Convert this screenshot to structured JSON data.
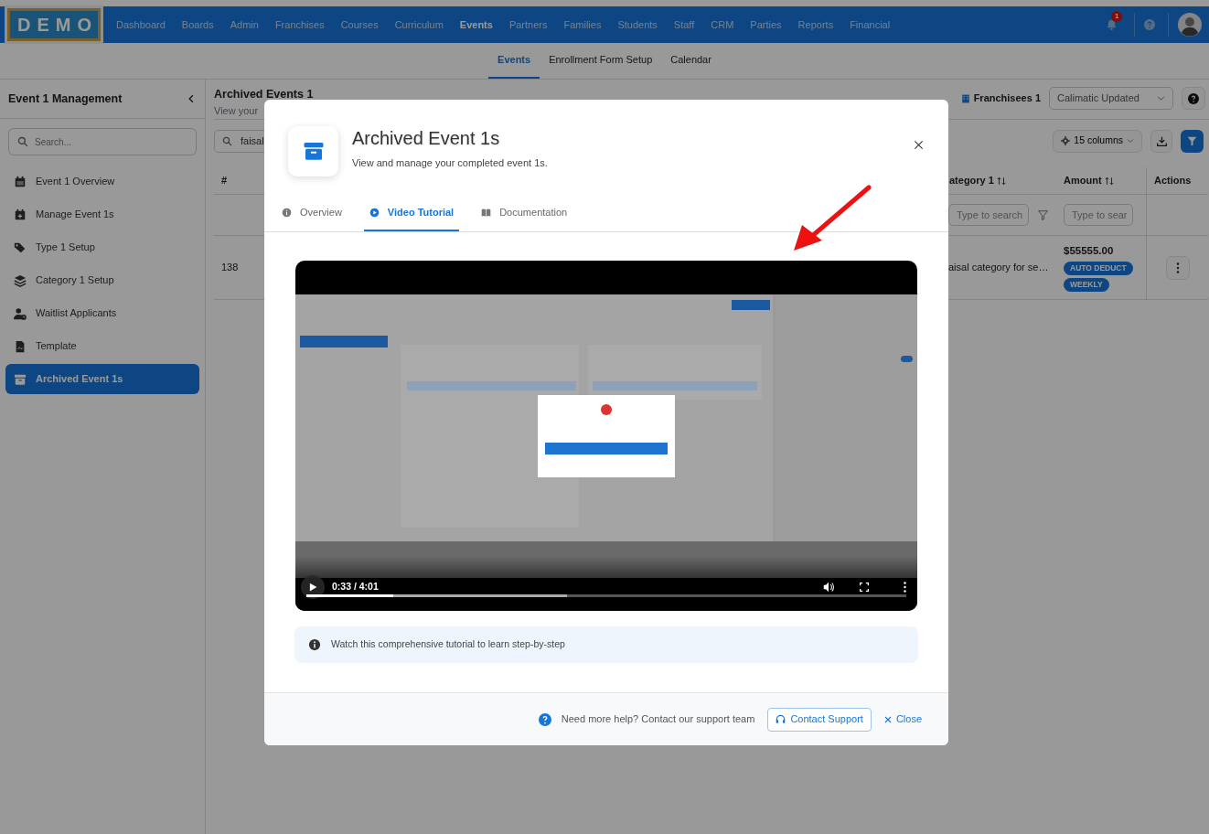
{
  "navbar": {
    "logo_text": "DEMO",
    "items": [
      {
        "label": "Dashboard",
        "selected": false
      },
      {
        "label": "Boards",
        "selected": false
      },
      {
        "label": "Admin",
        "selected": false
      },
      {
        "label": "Franchises",
        "selected": false
      },
      {
        "label": "Courses",
        "selected": false
      },
      {
        "label": "Curriculum",
        "selected": false
      },
      {
        "label": "Events",
        "selected": true
      },
      {
        "label": "Partners",
        "selected": false
      },
      {
        "label": "Families",
        "selected": false
      },
      {
        "label": "Students",
        "selected": false
      },
      {
        "label": "Staff",
        "selected": false
      },
      {
        "label": "CRM",
        "selected": false
      },
      {
        "label": "Parties",
        "selected": false
      },
      {
        "label": "Reports",
        "selected": false
      },
      {
        "label": "Financial",
        "selected": false
      }
    ],
    "notification_count": "1"
  },
  "subnav": [
    {
      "label": "Events",
      "selected": true
    },
    {
      "label": "Enrollment Form Setup",
      "selected": false
    },
    {
      "label": "Calendar",
      "selected": false
    }
  ],
  "sidebar": {
    "title": "Event 1 Management",
    "search_placeholder": "Search...",
    "items": [
      {
        "label": "Event 1 Overview",
        "selected": false
      },
      {
        "label": "Manage Event 1s",
        "selected": false
      },
      {
        "label": "Type 1 Setup",
        "selected": false
      },
      {
        "label": "Category 1 Setup",
        "selected": false
      },
      {
        "label": "Waitlist Applicants",
        "selected": false
      },
      {
        "label": "Template",
        "selected": false
      },
      {
        "label": "Archived Event 1s",
        "selected": true
      }
    ]
  },
  "page": {
    "title": "Archived Events 1",
    "subtitle": "View your",
    "search_value": "faisal",
    "franchise_label": "Franchisees 1",
    "franchise_select": "Calimatic Updated",
    "columns_button": "15 columns",
    "table": {
      "columns": [
        "#",
        "ategory 1",
        "Amount",
        "Actions"
      ],
      "filter_placeholders": [
        "Type to search",
        "Type to sear"
      ],
      "rows": [
        {
          "number": "138",
          "category": "aisal category for se…",
          "amount": "$55555.00",
          "tags": [
            "AUTO DEDUCT",
            "WEEKLY"
          ]
        }
      ]
    }
  },
  "modal": {
    "title": "Archived Event 1s",
    "subtitle": "View and manage your completed event 1s.",
    "tabs": [
      {
        "label": "Overview",
        "selected": false
      },
      {
        "label": "Video Tutorial",
        "selected": true
      },
      {
        "label": "Documentation",
        "selected": false
      }
    ],
    "video": {
      "kind": "picture",
      "time": "0:33 / 4:01",
      "level": 0.145
    },
    "info_text": "Watch this comprehensive tutorial to learn step-by-step",
    "footer": {
      "help_text": "Need more help? Contact our support team",
      "contact_button": "Contact Support",
      "close_button": "Close"
    }
  }
}
